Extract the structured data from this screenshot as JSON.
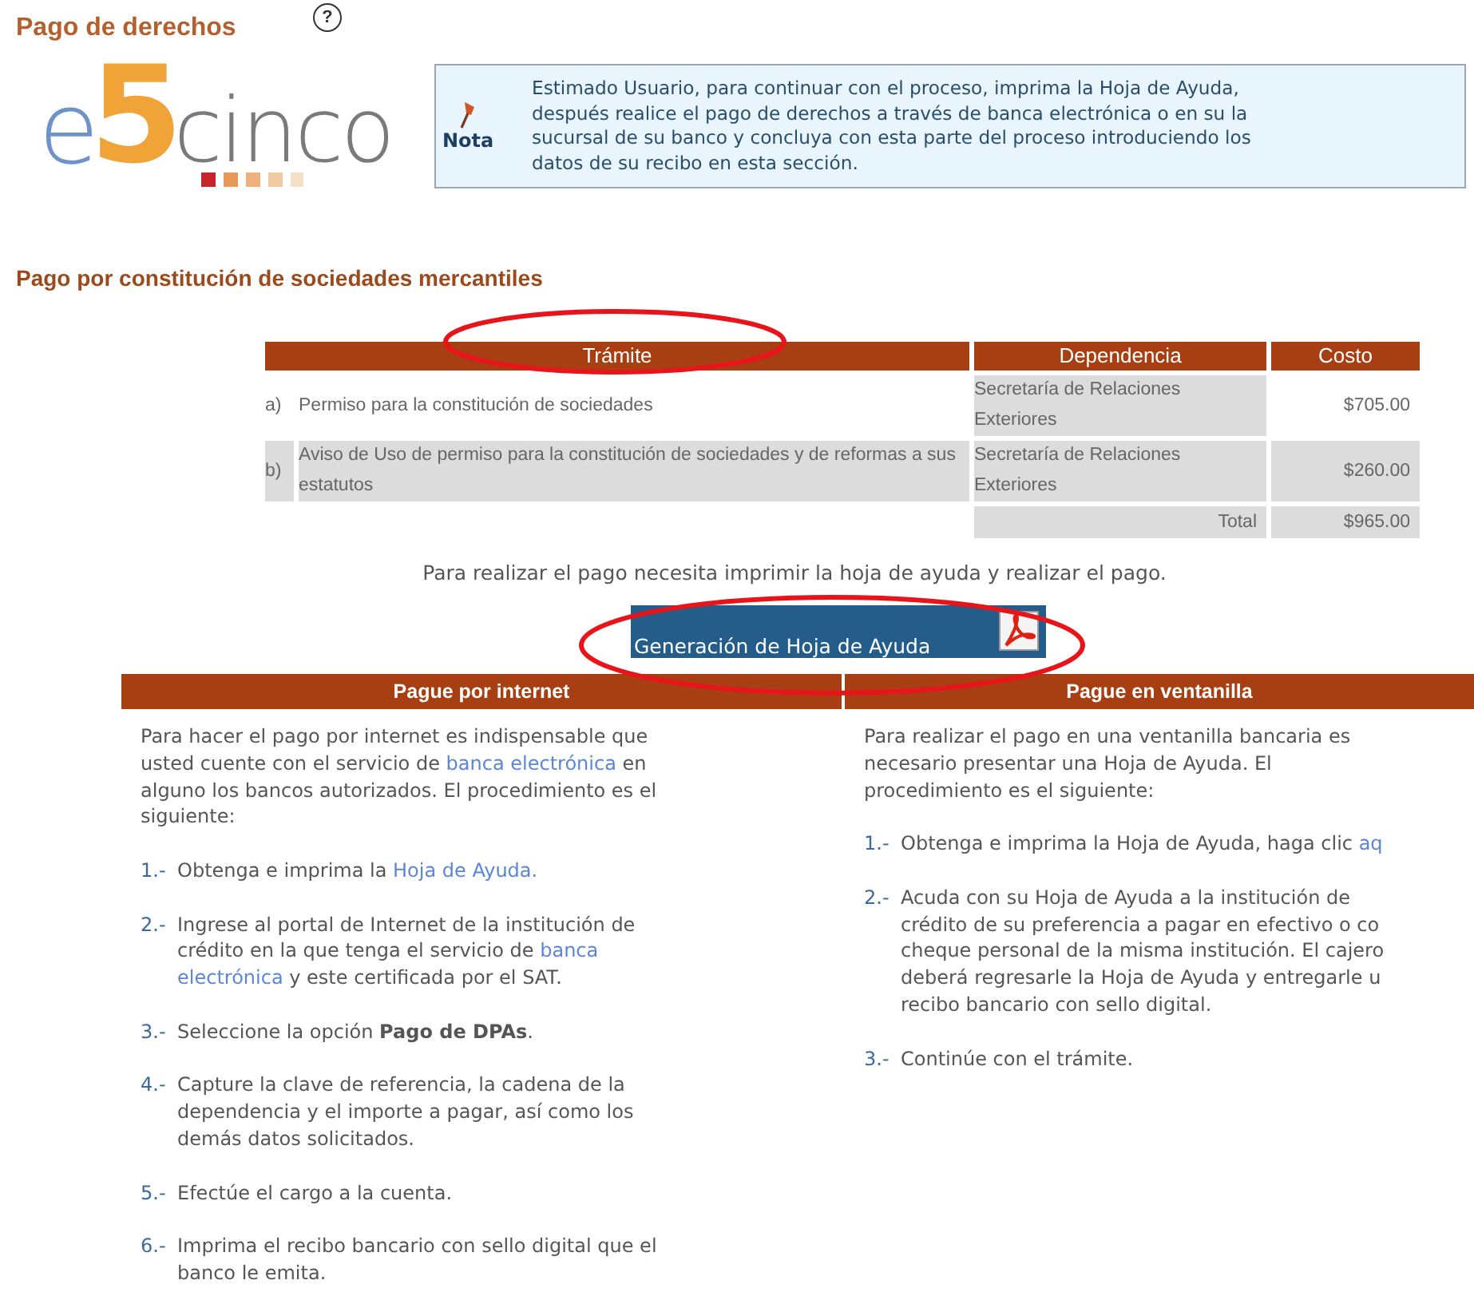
{
  "page_title": "Pago de derechos",
  "help_button": {
    "label": "?"
  },
  "logo": {
    "parts": [
      {
        "text": "e",
        "color": "#6f93c9"
      },
      {
        "text": "5",
        "color": "#f0a438"
      },
      {
        "text": "cinco",
        "color": "#7a7a7a"
      }
    ]
  },
  "note": {
    "label": "Nota",
    "text": "Estimado Usuario, para continuar con el proceso, imprima la Hoja de Ayuda,\ndespués realice el pago de derechos a través de banca electrónica o en su la\nsucursal de su banco y concluya con esta parte del proceso introduciendo los\ndatos de su recibo en esta sección."
  },
  "section_title": "Pago por constitución de sociedades mercantiles",
  "table": {
    "columns": [
      {
        "label": "Trámite",
        "circled": true
      },
      {
        "label": "Dependencia",
        "circled": false
      },
      {
        "label": "Costo",
        "circled": false
      }
    ],
    "rows": [
      {
        "letter": "a)",
        "tramite": "Permiso para la constitución de sociedades",
        "dependencia": "Secretaría de Relaciones Exteriores",
        "costo": "$705.00",
        "shaded": false
      },
      {
        "letter": "b)",
        "tramite": "Aviso de Uso de permiso para la constitución de sociedades y de reformas a sus estatutos",
        "dependencia": "Secretaría de Relaciones Exteriores",
        "costo": "$260.00",
        "shaded": true
      }
    ],
    "total": {
      "label": "Total",
      "value": "$965.00"
    }
  },
  "instruction": "Para realizar el pago necesita imprimir la hoja de ayuda y realizar el pago.",
  "pdf_button": {
    "label": "Generación de Hoja de Ayuda",
    "circled": true
  },
  "columns": [
    {
      "title": "Pague por internet",
      "intro": [
        {
          "text": "Para hacer el pago por internet es indispensable que\nusted cuente con el servicio de ",
          "link": false
        },
        {
          "text": "banca electrónica",
          "link": true
        },
        {
          "text": " en\nalguno los bancos autorizados. El procedimiento es el\nsiguiente:",
          "link": false
        }
      ],
      "steps": [
        {
          "number": "1.-",
          "segments": [
            {
              "text": "Obtenga e imprima la ",
              "link": false
            },
            {
              "text": "Hoja de Ayuda.",
              "link": true
            }
          ]
        },
        {
          "number": "2.-",
          "segments": [
            {
              "text": "Ingrese al portal de Internet de la institución de\ncrédito en la que tenga el servicio de ",
              "link": false
            },
            {
              "text": "banca",
              "link": true
            },
            {
              "text": "electrónica",
              "link": true,
              "new_line": true
            },
            {
              "text": " y este certificada por el SAT.",
              "link": false
            }
          ]
        },
        {
          "number": "3.-",
          "segments": [
            {
              "text": "Seleccione la opción **Pago de DPAs**.",
              "link": false
            }
          ]
        },
        {
          "number": "4.-",
          "segments": [
            {
              "text": "Capture la clave de referencia, la cadena de la\ndependencia y el importe a pagar, así como los\ndemás datos solicitados.",
              "link": false
            }
          ]
        },
        {
          "number": "5.-",
          "segments": [
            {
              "text": "Efectúe el cargo a la cuenta.",
              "link": false
            }
          ]
        },
        {
          "number": "6.-",
          "segments": [
            {
              "text": "Imprima el recibo bancario con sello digital que el\nbanco le emita.",
              "link": false
            }
          ]
        }
      ]
    },
    {
      "title": "Pague en ventanilla",
      "intro": [
        {
          "text": "Para realizar el pago en una ventanilla bancaria es\nnecesario presentar una Hoja de Ayuda. El\nprocedimiento es el siguiente:",
          "link": false
        }
      ],
      "steps": [
        {
          "number": "1.-",
          "segments": [
            {
              "text": "Obtenga e imprima la Hoja de Ayuda, haga clic ",
              "link": false
            },
            {
              "text": "aq",
              "link": true
            }
          ]
        },
        {
          "number": "2.-",
          "segments": [
            {
              "text": "Acuda con su Hoja de Ayuda a la institución de\ncrédito de su preferencia a pagar en efectivo o co\ncheque personal de la misma institución. El cajero\ndeberá regresarle la Hoja de Ayuda y entregarle u\nrecibo bancario con sello digital.",
              "link": false
            }
          ]
        },
        {
          "number": "3.-",
          "segments": [
            {
              "text": "Continúe con el trámite.",
              "link": false
            }
          ]
        }
      ]
    }
  ]
}
